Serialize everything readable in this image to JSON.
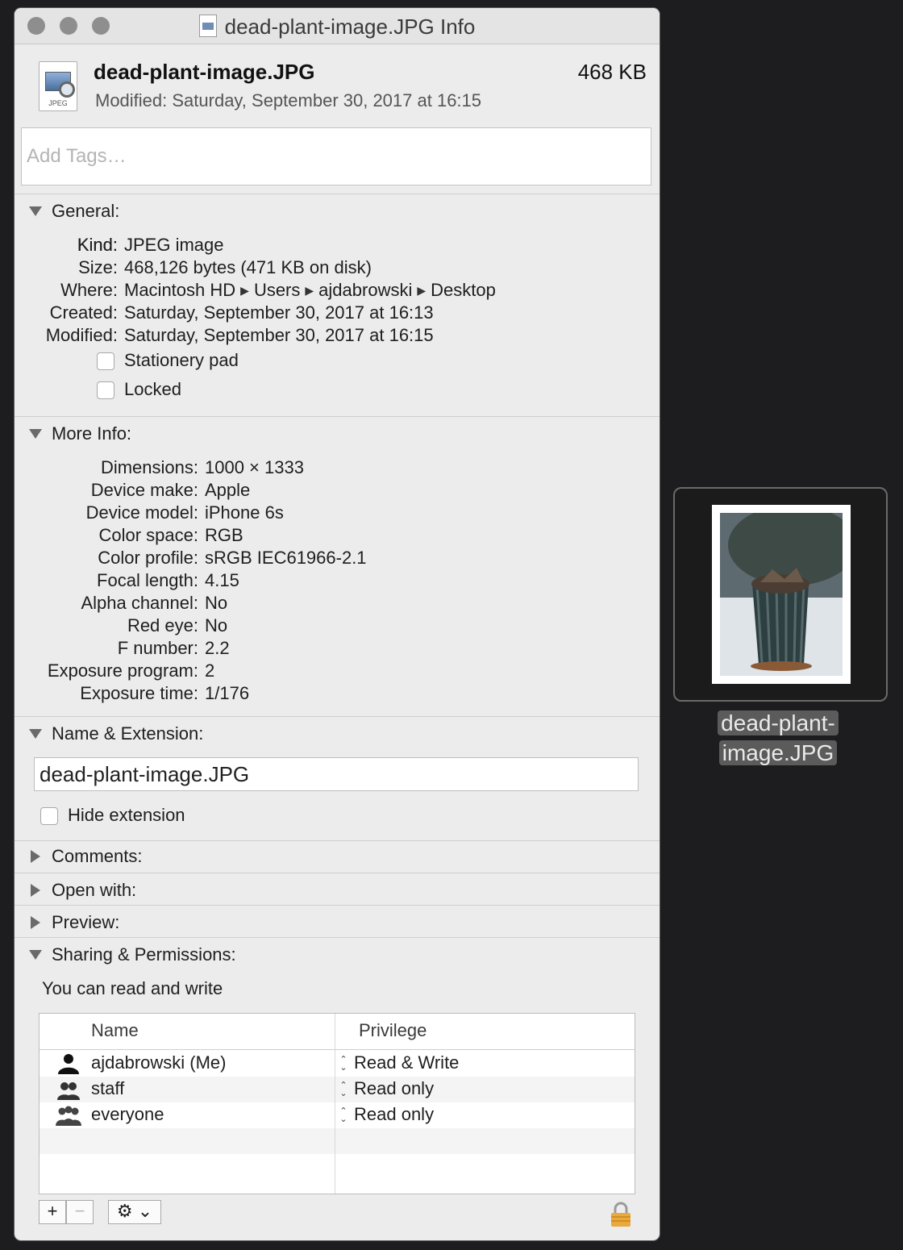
{
  "window": {
    "title": "dead-plant-image.JPG Info"
  },
  "header": {
    "filename": "dead-plant-image.JPG",
    "size": "468 KB",
    "modified": "Modified: Saturday, September 30, 2017 at 16:15",
    "icon_label": "JPEG"
  },
  "tags": {
    "placeholder": "Add Tags…"
  },
  "general": {
    "title": "General:",
    "kind_k": "Kind:",
    "kind_v": "JPEG image",
    "size_k": "Size:",
    "size_v": "468,126 bytes (471 KB on disk)",
    "where_k": "Where:",
    "where_path": [
      "Macintosh HD",
      "Users",
      "ajdabrowski",
      "Desktop"
    ],
    "created_k": "Created:",
    "created_v": "Saturday, September 30, 2017 at 16:13",
    "modified_k": "Modified:",
    "modified_v": "Saturday, September 30, 2017 at 16:15",
    "stationery": "Stationery pad",
    "locked": "Locked"
  },
  "more_info": {
    "title": "More Info:",
    "rows": [
      {
        "k": "Dimensions:",
        "v": "1000 × 1333"
      },
      {
        "k": "Device make:",
        "v": "Apple"
      },
      {
        "k": "Device model:",
        "v": "iPhone 6s"
      },
      {
        "k": "Color space:",
        "v": "RGB"
      },
      {
        "k": "Color profile:",
        "v": "sRGB IEC61966-2.1"
      },
      {
        "k": "Focal length:",
        "v": "4.15"
      },
      {
        "k": "Alpha channel:",
        "v": "No"
      },
      {
        "k": "Red eye:",
        "v": "No"
      },
      {
        "k": "F number:",
        "v": "2.2"
      },
      {
        "k": "Exposure program:",
        "v": "2"
      },
      {
        "k": "Exposure time:",
        "v": "1/176"
      }
    ]
  },
  "name_ext": {
    "title": "Name & Extension:",
    "value": "dead-plant-image.JPG",
    "hide_ext": "Hide extension"
  },
  "collapsed": {
    "comments": "Comments:",
    "open_with": "Open with:",
    "preview": "Preview:"
  },
  "sharing": {
    "title": "Sharing & Permissions:",
    "status": "You can read and write",
    "col_name": "Name",
    "col_priv": "Privilege",
    "rows": [
      {
        "name": "ajdabrowski (Me)",
        "priv": "Read & Write",
        "icon": "single-user-icon"
      },
      {
        "name": "staff",
        "priv": "Read only",
        "icon": "group-icon"
      },
      {
        "name": "everyone",
        "priv": "Read only",
        "icon": "everyone-icon"
      }
    ],
    "add_label": "+",
    "remove_label": "−",
    "action_label": "⚙︎ ⌄"
  },
  "thumbnail": {
    "caption_line1": "dead-plant-",
    "caption_line2": "image.JPG"
  }
}
